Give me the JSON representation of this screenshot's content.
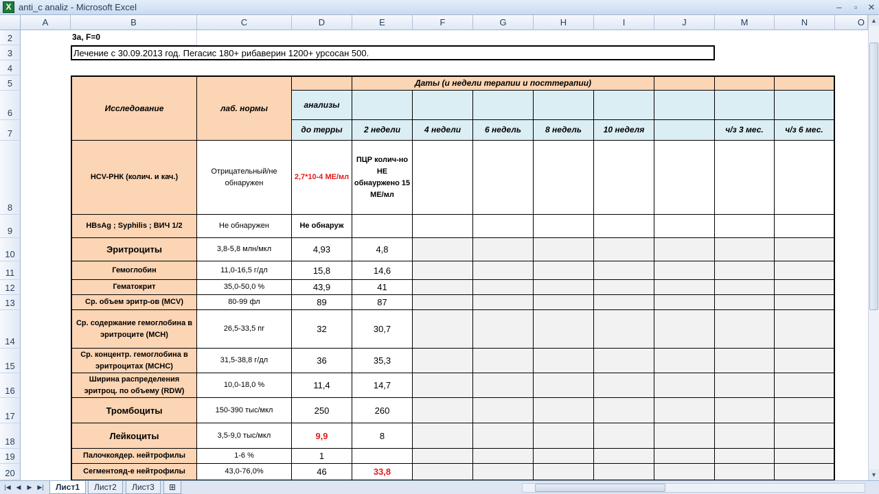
{
  "window": {
    "title": "anti_c analiz - Microsoft Excel",
    "app_icon": "X",
    "min_glyph": "–",
    "max_glyph": "▫",
    "close_glyph": "✕"
  },
  "columns": [
    "A",
    "B",
    "C",
    "D",
    "E",
    "F",
    "G",
    "H",
    "I",
    "J",
    "M",
    "N",
    "O"
  ],
  "rows": [
    "2",
    "3",
    "4",
    "5",
    "6",
    "7",
    "8",
    "9",
    "10",
    "11",
    "12",
    "13",
    "14",
    "15",
    "16",
    "17",
    "18",
    "19",
    "20"
  ],
  "header_cells": {
    "genotype": "3a, F=0",
    "treatment": "Лечение с 30.09.2013 год. Пегасис 180+ рибаверин 1200+ урсосан 500.",
    "dates_title": "Даты    (и  недели  терапии и посттерапии)",
    "study": "Исследование",
    "norms": "лаб. нормы",
    "tests": "анализы",
    "before": "до терры",
    "w2": "2 недели",
    "w4": "4 недели",
    "w6": "6 недель",
    "w8": "8 недель",
    "w10": "10 неделя",
    "m3": "ч/з 3 мес.",
    "m6": "ч/з 6 мес."
  },
  "data_rows": [
    {
      "name": "HCV-РНК (колич. и кач.)",
      "norm": "Отрицательный/не обнаружен",
      "d": "2,7*10-4 МЕ/мл",
      "e": "ПЦР колич-но НЕ обнауржено 15 МЕ/мл"
    },
    {
      "name": "HBsAg ; Syphilis ; ВИЧ 1/2",
      "norm": "Не обнаружен",
      "d": "Не обнаруж",
      "e": ""
    },
    {
      "name": "Эритроциты",
      "norm": "3,8-5,8 млн/мкл",
      "d": "4,93",
      "e": "4,8"
    },
    {
      "name": "Гемоглобин",
      "norm": "11,0-16,5 г/дл",
      "d": "15,8",
      "e": "14,6"
    },
    {
      "name": "Гематокрит",
      "norm": "35,0-50,0 %",
      "d": "43,9",
      "e": "41"
    },
    {
      "name": "Ср. объем эритр-ов (MCV)",
      "norm": "80-99 фл",
      "d": "89",
      "e": "87"
    },
    {
      "name": "Ср. содержание гемоглобина в эритроците (MCH)",
      "norm": "26,5-33,5 пг",
      "d": "32",
      "e": "30,7"
    },
    {
      "name": "Ср. концентр. гемоглобина в эритроцитах (MCHC)",
      "norm": "31,5-38,8 г/дл",
      "d": "36",
      "e": "35,3"
    },
    {
      "name": "Ширина распределения эритроц. по объему (RDW)",
      "norm": "10,0-18,0 %",
      "d": "11,4",
      "e": "14,7"
    },
    {
      "name": "Тромбоциты",
      "norm": "150-390 тыс/мкл",
      "d": "250",
      "e": "260"
    },
    {
      "name": "Лейкоциты",
      "norm": "3,5-9,0 тыс/мкл",
      "d": "9,9",
      "e": "8"
    },
    {
      "name": "Палочкоядер. нейтрофилы",
      "norm": "1-6 %",
      "d": "1",
      "e": ""
    },
    {
      "name": "Сегментояд-е нейтрофилы",
      "norm": "43,0-76,0%",
      "d": "46",
      "e": "33,8"
    }
  ],
  "sheets": [
    "Лист1",
    "Лист2",
    "Лист3"
  ],
  "colors": {
    "peach": "#fcd5b4",
    "light_blue": "#dbeef3",
    "grey": "#f2f2f2",
    "red_text": "#e21b1b"
  }
}
